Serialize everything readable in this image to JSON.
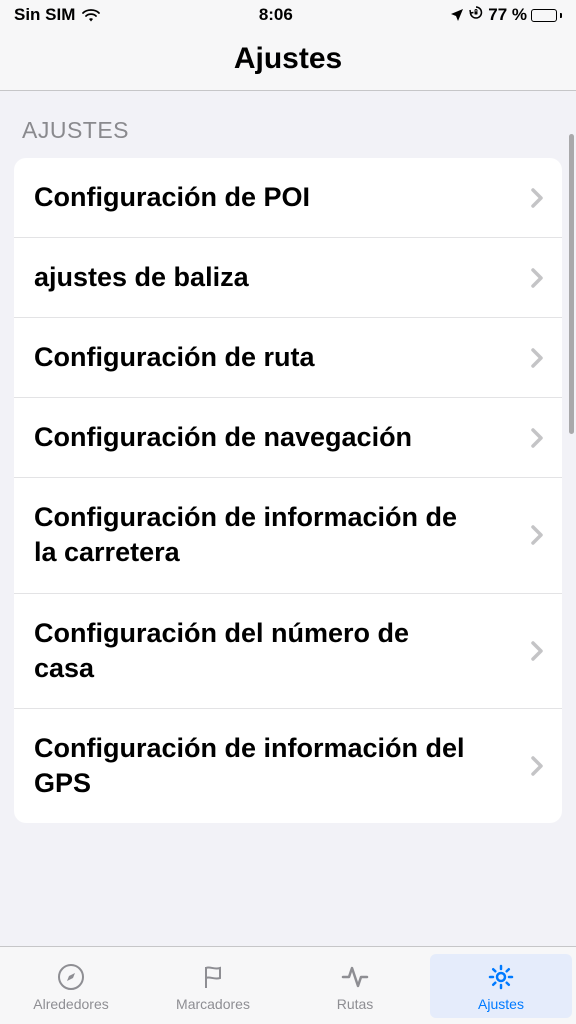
{
  "statusBar": {
    "sim": "Sin SIM",
    "time": "8:06",
    "battery": "77 %"
  },
  "header": {
    "title": "Ajustes"
  },
  "sectionHeader": "AJUSTES",
  "items": [
    {
      "label": "Configuración de POI"
    },
    {
      "label": "ajustes de baliza"
    },
    {
      "label": "Configuración de ruta"
    },
    {
      "label": "Configuración de navegación"
    },
    {
      "label": "Configuración de información de la carretera"
    },
    {
      "label": "Configuración del número de casa"
    },
    {
      "label": "Configuración de información del GPS"
    }
  ],
  "tabs": [
    {
      "label": "Alrededores",
      "icon": "compass",
      "active": false
    },
    {
      "label": "Marcadores",
      "icon": "flag",
      "active": false
    },
    {
      "label": "Rutas",
      "icon": "activity",
      "active": false
    },
    {
      "label": "Ajustes",
      "icon": "gear",
      "active": true
    }
  ]
}
